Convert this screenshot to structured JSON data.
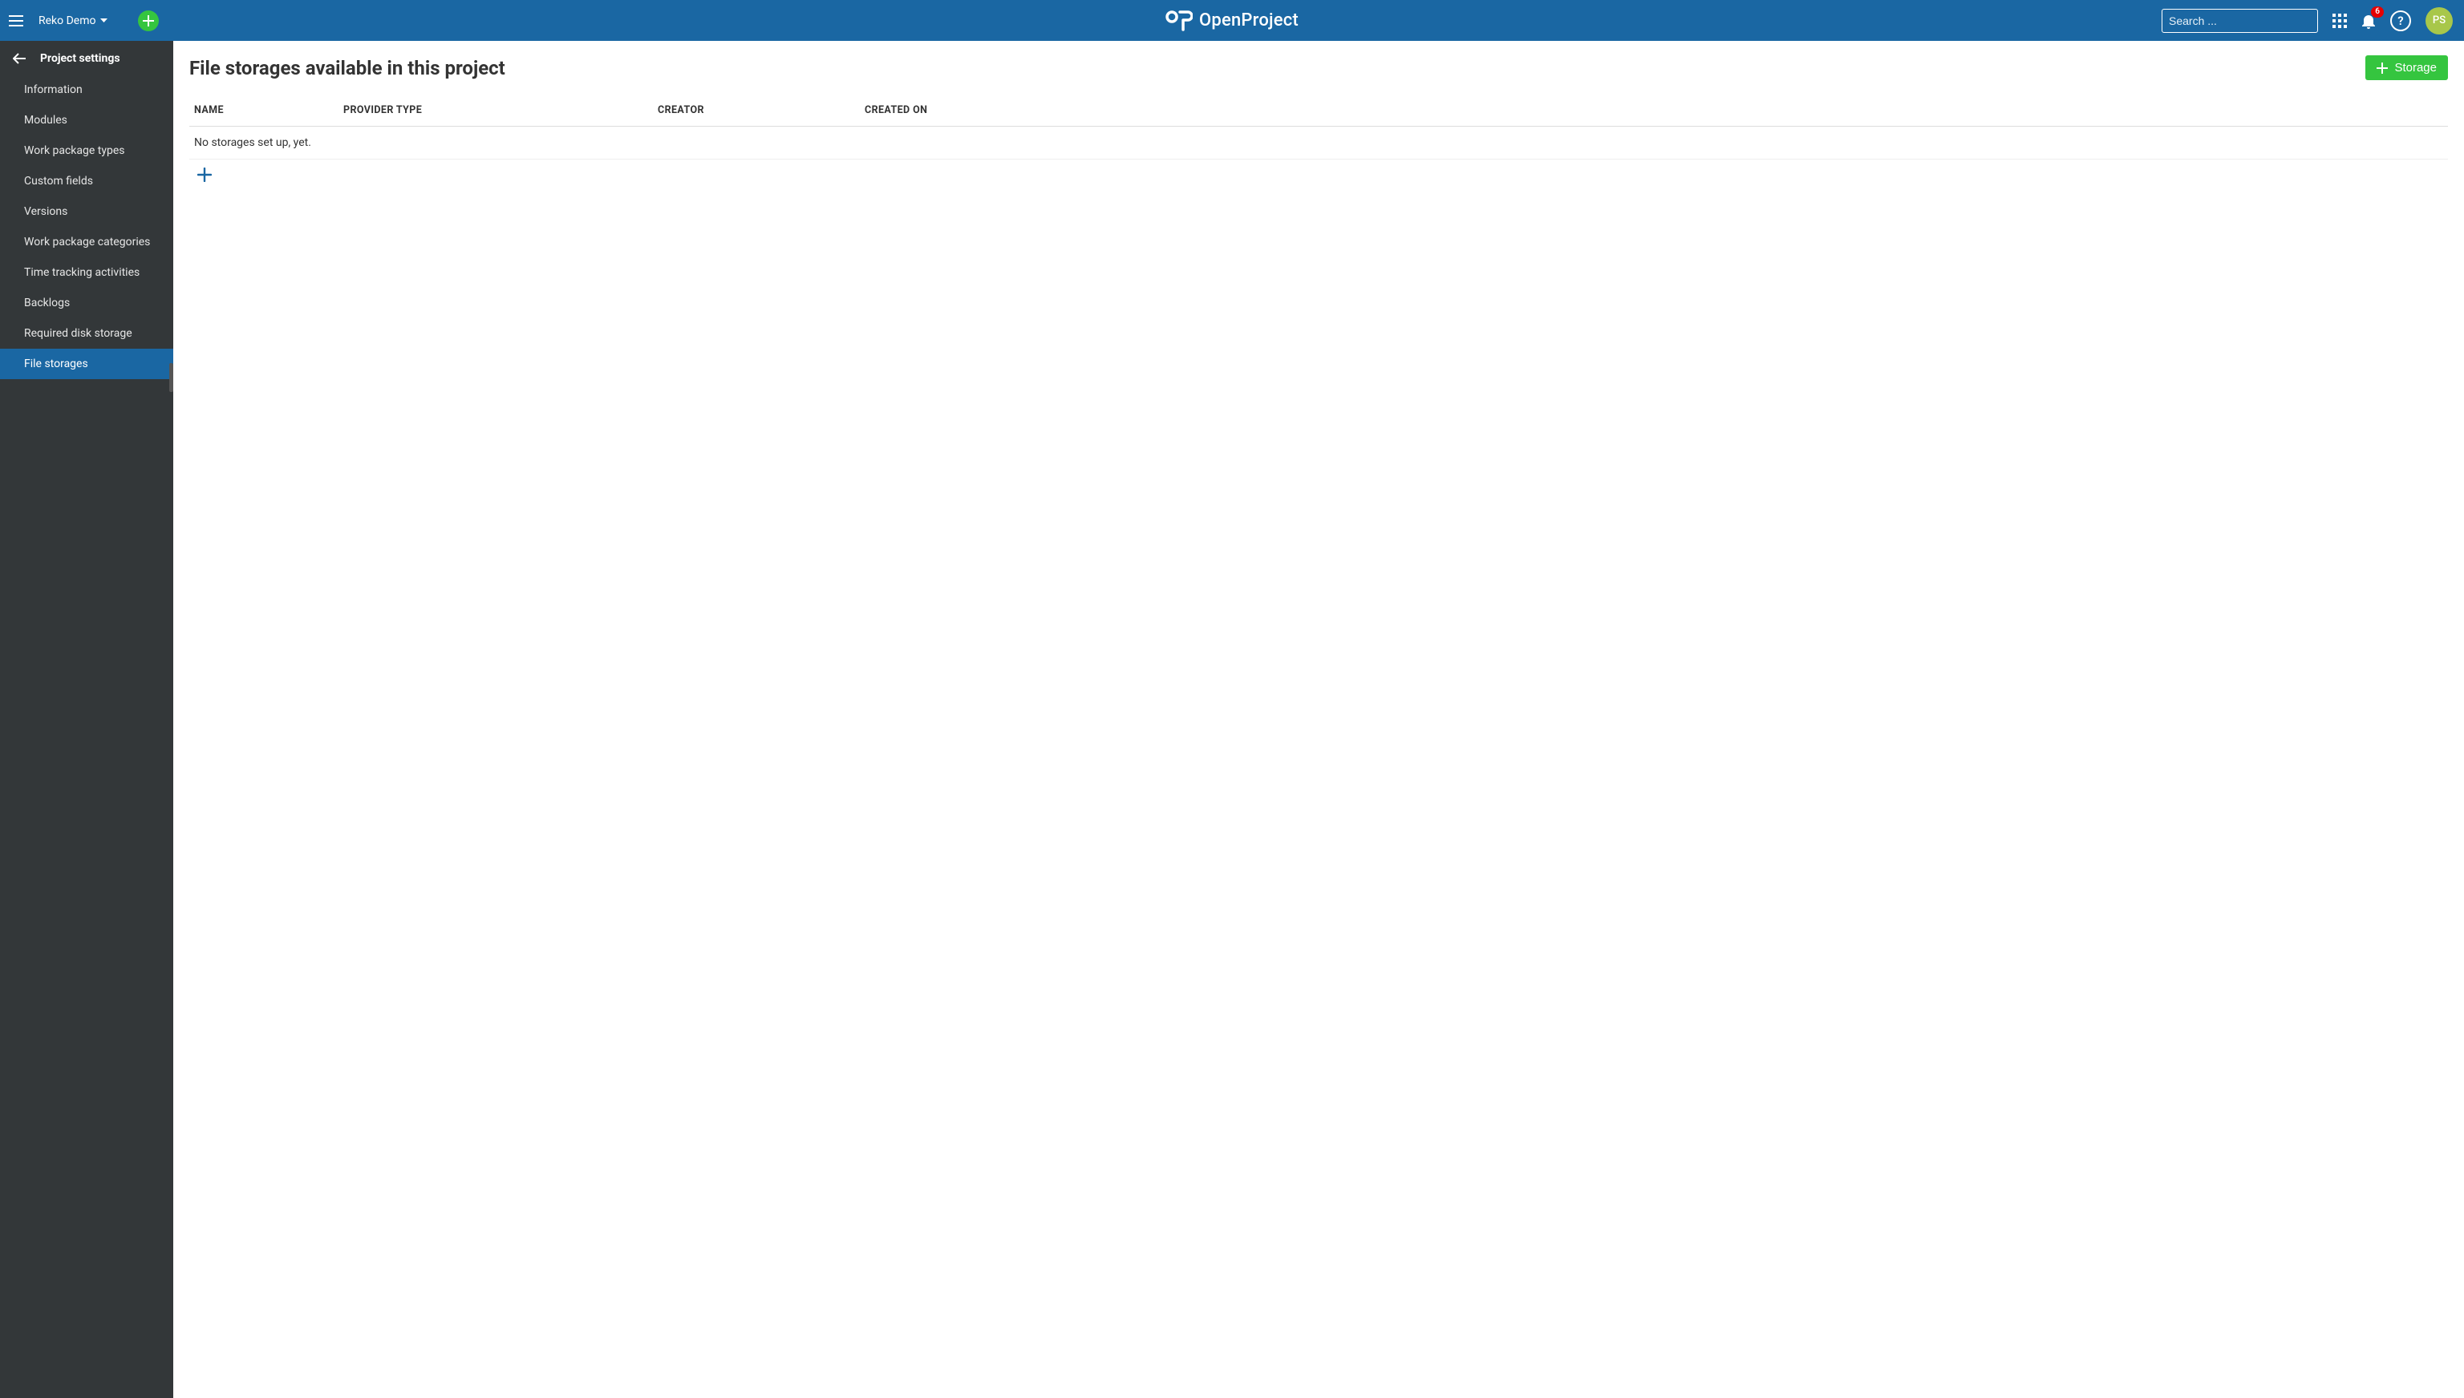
{
  "header": {
    "project_name": "Reko Demo",
    "search_placeholder": "Search ...",
    "notification_count": "6",
    "avatar_initials": "PS",
    "brand_text": "OpenProject",
    "help_glyph": "?"
  },
  "sidebar": {
    "title": "Project settings",
    "items": [
      {
        "label": "Information",
        "active": false
      },
      {
        "label": "Modules",
        "active": false
      },
      {
        "label": "Work package types",
        "active": false
      },
      {
        "label": "Custom fields",
        "active": false
      },
      {
        "label": "Versions",
        "active": false
      },
      {
        "label": "Work package categories",
        "active": false
      },
      {
        "label": "Time tracking activities",
        "active": false
      },
      {
        "label": "Backlogs",
        "active": false
      },
      {
        "label": "Required disk storage",
        "active": false
      },
      {
        "label": "File storages",
        "active": true
      }
    ]
  },
  "main": {
    "title": "File storages available in this project",
    "add_button_label": "Storage",
    "columns": {
      "name": "NAME",
      "provider": "PROVIDER TYPE",
      "creator": "CREATOR",
      "created_on": "CREATED ON"
    },
    "empty_message": "No storages set up, yet."
  }
}
